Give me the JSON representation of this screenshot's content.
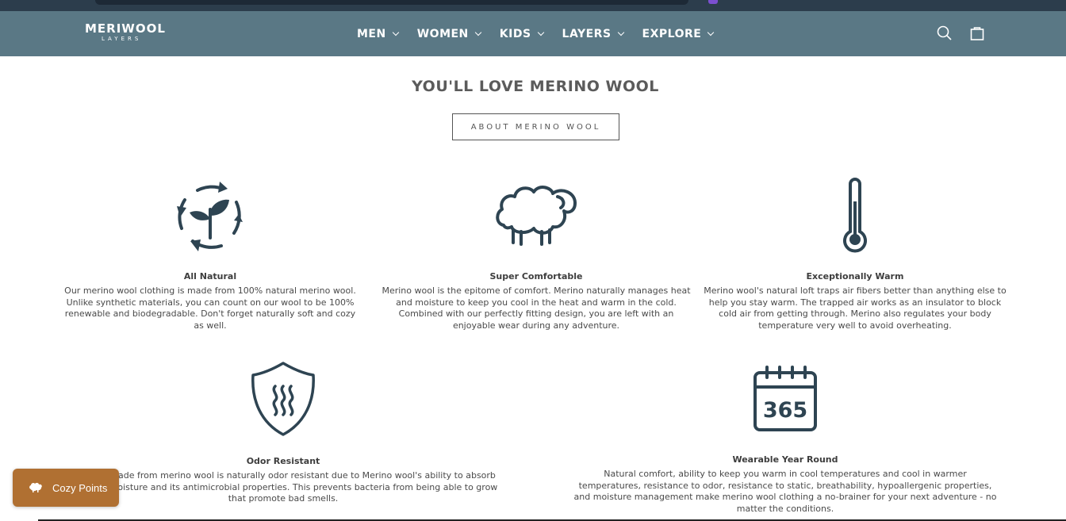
{
  "brand": {
    "name": "MERIWOOL",
    "subtitle": "LAYERS"
  },
  "nav": [
    {
      "label": "MEN"
    },
    {
      "label": "WOMEN"
    },
    {
      "label": "KIDS"
    },
    {
      "label": "LAYERS"
    },
    {
      "label": "EXPLORE"
    }
  ],
  "header_icons": [
    "search-icon",
    "cart-icon"
  ],
  "section": {
    "title": "YOU'LL LOVE MERINO WOOL",
    "button_label": "ABOUT MERINO WOOL"
  },
  "features": [
    {
      "icon": "recycle-sprout-icon",
      "title": "All Natural",
      "text": "Our merino wool clothing is made from 100% natural merino wool. Unlike synthetic materials, you can count on our wool to be 100% renewable and biodegradable. Don't forget naturally soft and cozy as well."
    },
    {
      "icon": "sheep-icon",
      "title": "Super Comfortable",
      "text": "Merino wool is the epitome of comfort. Merino naturally manages heat and moisture to keep you cool in the heat and warm in the cold. Combined with our perfectly fitting design, you are left with an enjoyable wear during any adventure."
    },
    {
      "icon": "thermometer-icon",
      "title": "Exceptionally Warm",
      "text": "Merino wool's natural loft traps air fibers better than anything else to help you stay warm. The trapped air works as an insulator to block cold air from getting through. Merino also regulates your body temperature very well to avoid overheating."
    },
    {
      "icon": "shield-icon",
      "title": "Odor Resistant",
      "text": "Clothing made from merino wool is naturally odor resistant due to Merino wool's ability to absorb and stay moisture and its antimicrobial properties. This prevents bacteria from being able to grow that promote bad smells."
    },
    {
      "icon": "calendar-365-icon",
      "title": "Wearable Year Round",
      "calendar_number": "365",
      "text": "Natural comfort, ability to keep you warm in cool temperatures and cool in warmer temperatures, resistance to odor, resistance to static, breathability, hypoallergenic properties, and moisture management make merino wool clothing a no-brainer for your next adventure - no matter the conditions."
    }
  ],
  "cozy_points": {
    "label": "Cozy Points",
    "icon": "sheep-icon",
    "color": "#b07032"
  },
  "colors": {
    "header": "#5a7885",
    "top_strip": "#2c3d4c",
    "icon_stroke": "#2e4452"
  }
}
